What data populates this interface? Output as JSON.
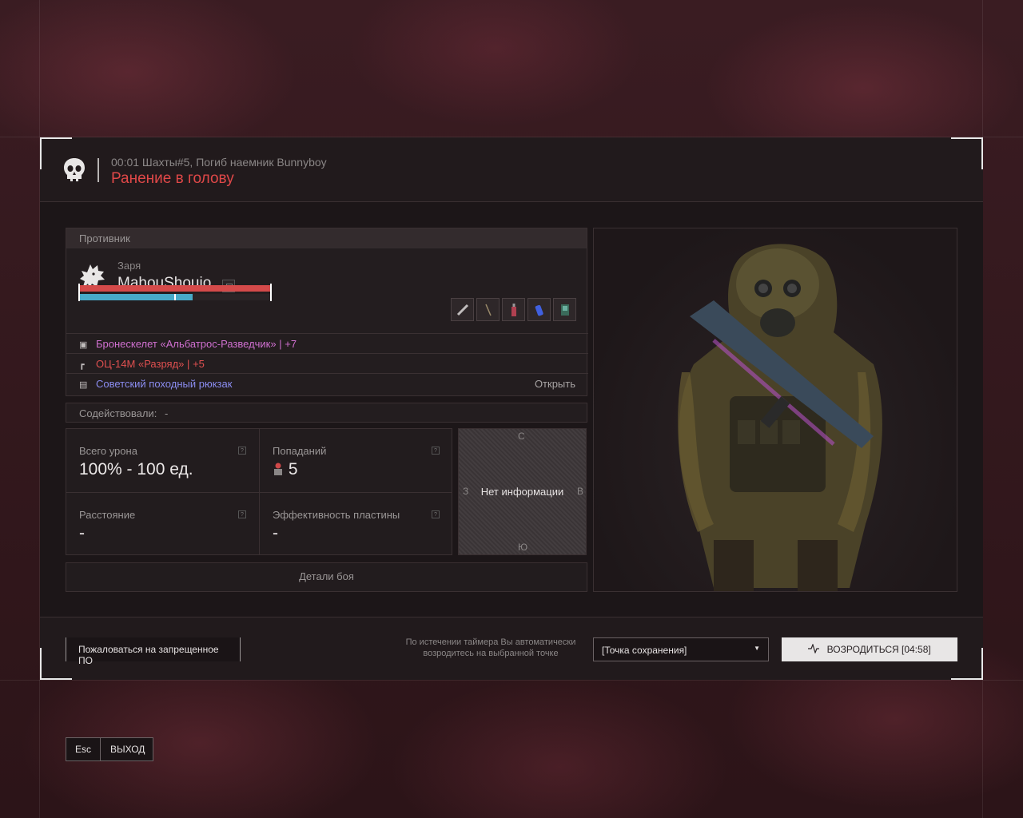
{
  "header": {
    "event": "00:01 Шахты#5, Погиб наемник Bunnyboy",
    "cause": "Ранение в голову"
  },
  "enemy": {
    "section_title": "Противник",
    "clan": "Заря",
    "nickname": "MahouShoujo",
    "health_fraction": 1.0,
    "armor_fraction": 0.59,
    "quick_items": [
      "knife-icon",
      "stick-icon",
      "bottle-icon",
      "canister-icon",
      "device-icon"
    ],
    "equipment": [
      {
        "icon": "armor-icon",
        "name": "Бронескелет «Альбатрос-Разведчик»",
        "sep": "|",
        "bonus": "+7",
        "color": "#d070d0"
      },
      {
        "icon": "gun-icon",
        "name": "ОЦ-14М «Разряд»",
        "sep": "|",
        "bonus": "+5",
        "color": "#e05050"
      },
      {
        "icon": "backpack-icon",
        "name": "Советский походный рюкзак",
        "color": "#8a8cf0",
        "action": "Открыть"
      }
    ]
  },
  "assist": {
    "label": "Содействовали:",
    "value": "-"
  },
  "stats": {
    "damage_label": "Всего урона",
    "damage_value": "100% - 100 ед.",
    "hits_label": "Попаданий",
    "hits_value": "5",
    "distance_label": "Расстояние",
    "distance_value": "-",
    "plate_label": "Эффективность пластины",
    "plate_value": "-"
  },
  "map": {
    "north": "С",
    "south": "Ю",
    "west": "З",
    "east": "В",
    "no_info": "Нет информации"
  },
  "details_button": "Детали боя",
  "footer": {
    "report_button": "Пожаловаться на запрещенное ПО",
    "timer_line1": "По истечении таймера Вы автоматически",
    "timer_line2": "возродитесь на выбранной точке",
    "respawn_point": "[Точка сохранения]",
    "respawn_button": "ВОЗРОДИТЬСЯ [04:58]"
  },
  "exit": {
    "key": "Esc",
    "label": "ВЫХОД"
  },
  "colors": {
    "accent_red": "#e04848",
    "panel": "#1c1618",
    "armor_bar": "#48aac8"
  }
}
